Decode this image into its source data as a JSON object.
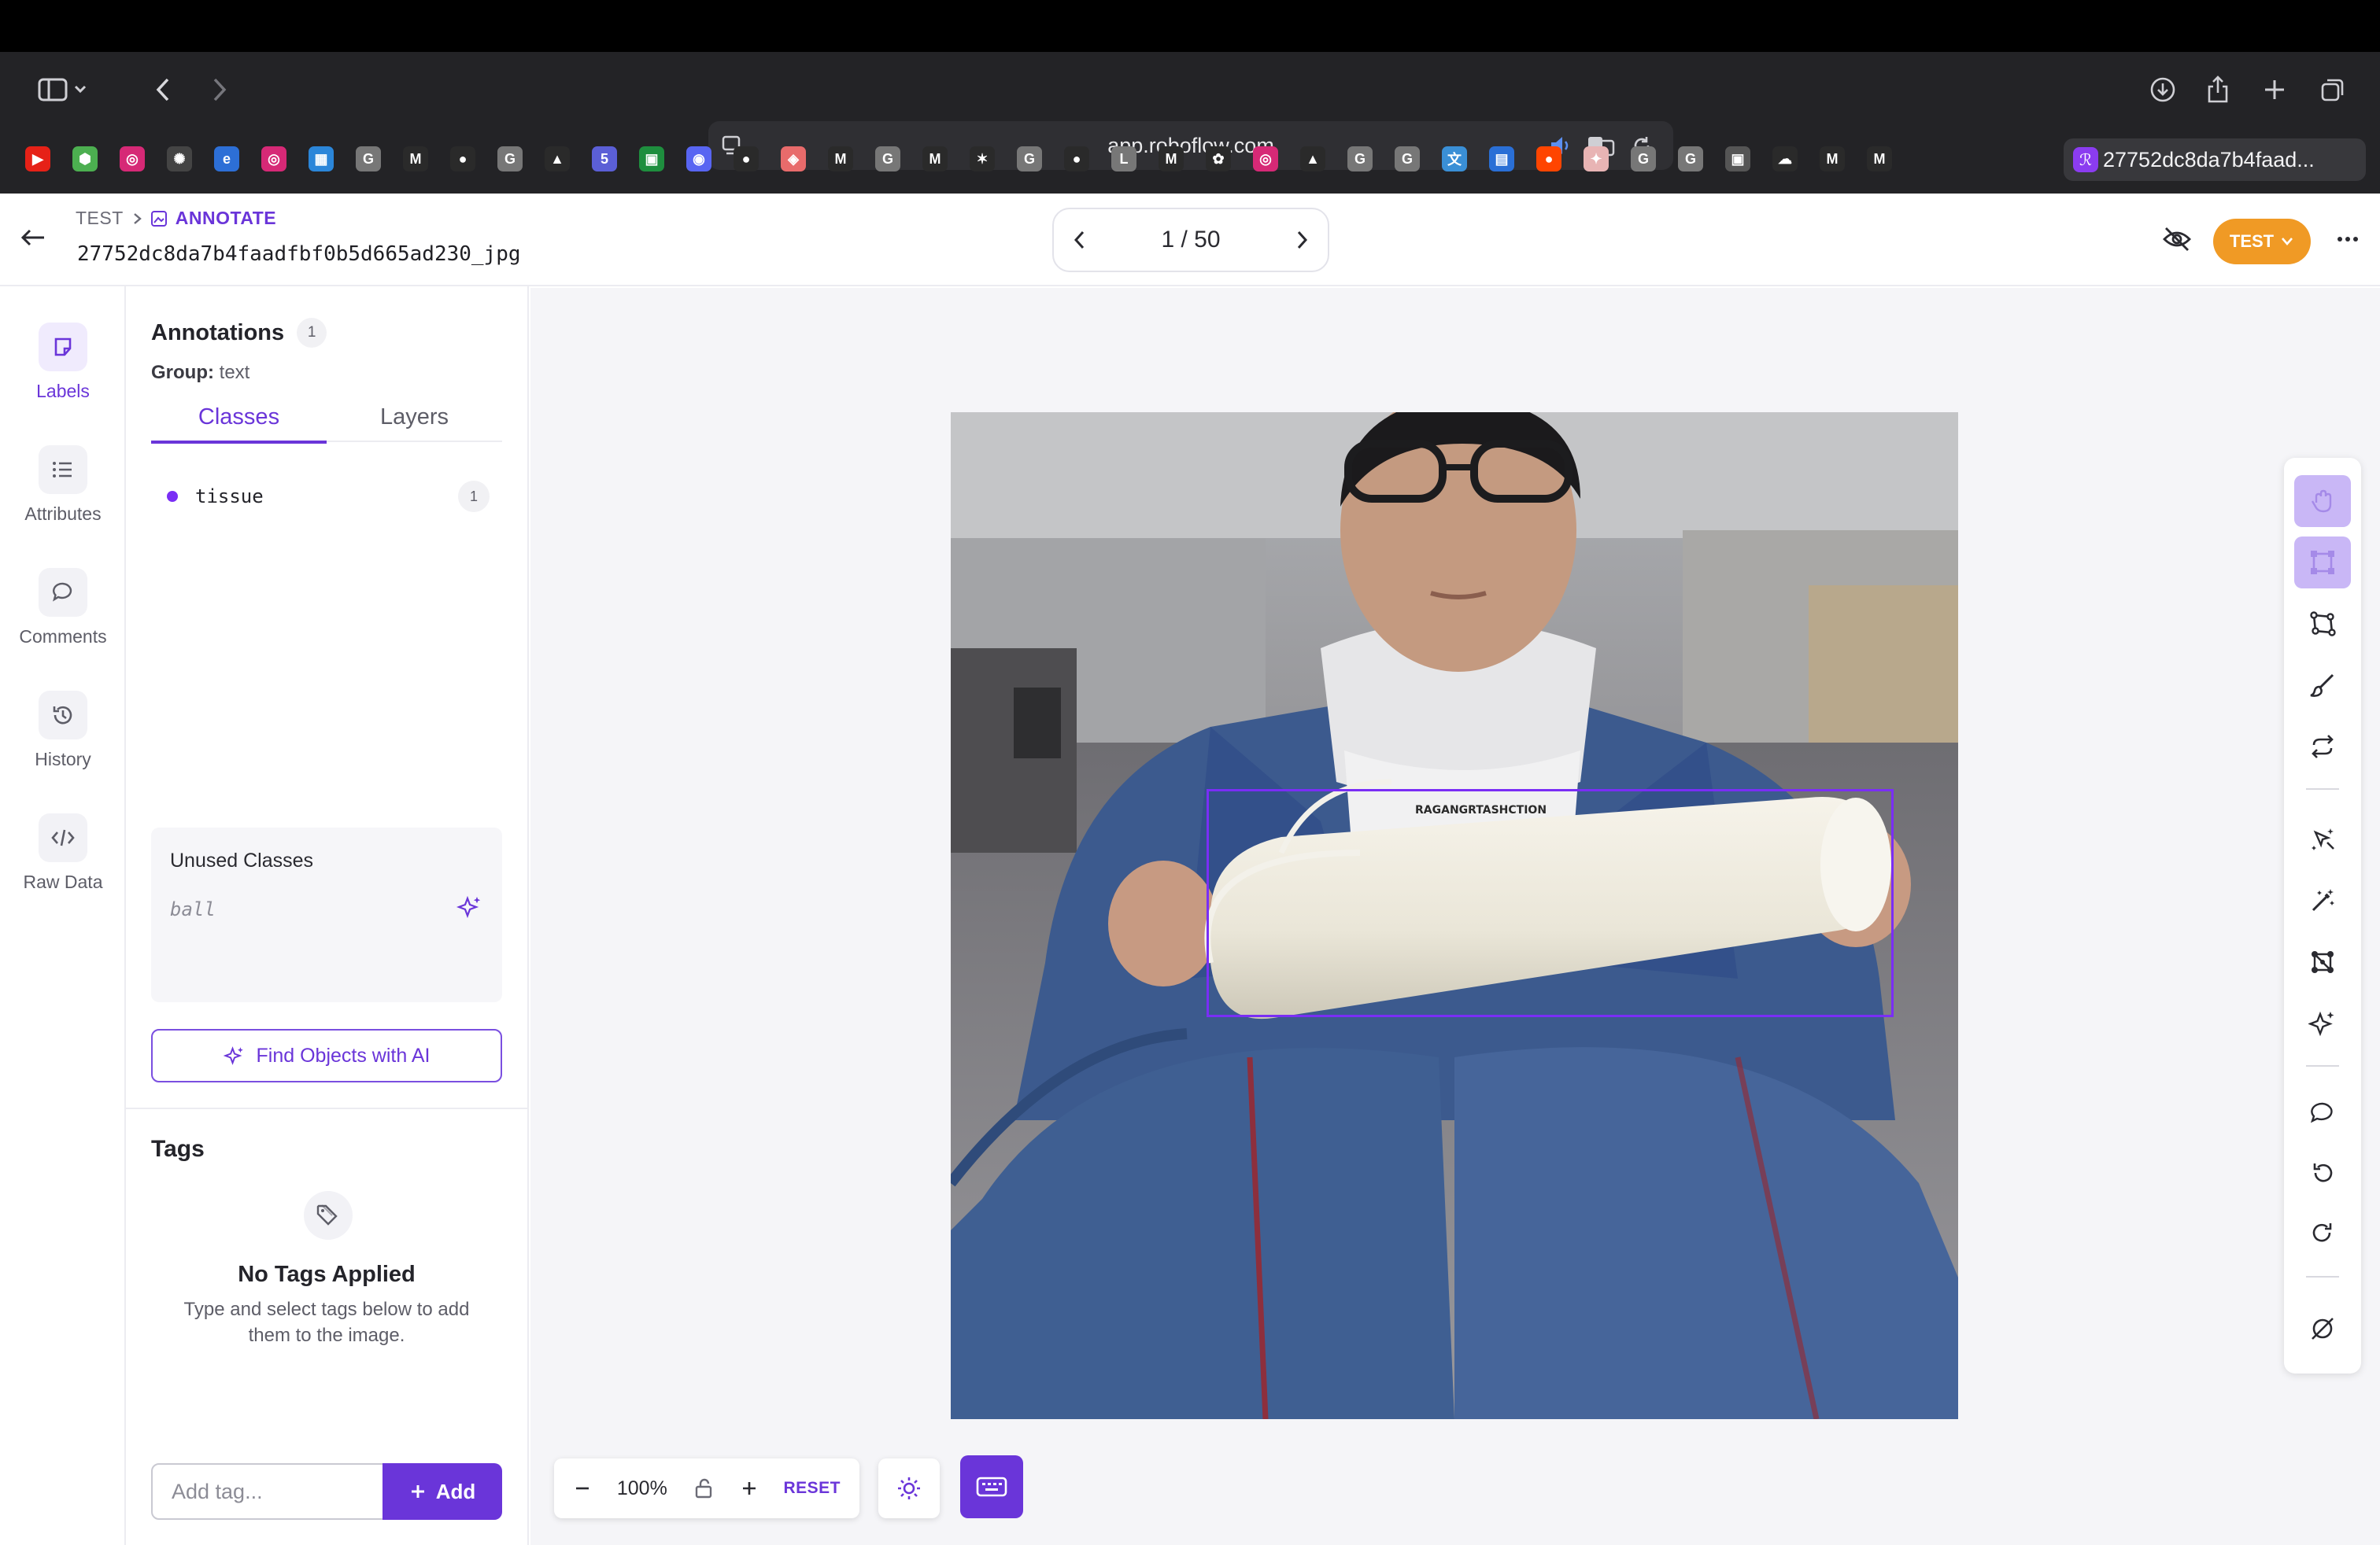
{
  "browser": {
    "url": "app.roboflow.com",
    "active_tab_title": "27752dc8da7b4faad...",
    "bookmarks": [
      {
        "icon": "youtube-icon",
        "color": "#e62117",
        "glyph": "▶"
      },
      {
        "icon": "hex-app-icon",
        "color": "#4caf50",
        "glyph": "⬢"
      },
      {
        "icon": "instagram-icon",
        "color": "#d62976",
        "glyph": "◎"
      },
      {
        "icon": "openai-icon",
        "color": "#444444",
        "glyph": "✺"
      },
      {
        "icon": "edge-icon",
        "color": "#2d6fd6",
        "glyph": "e"
      },
      {
        "icon": "instagram-icon",
        "color": "#d62976",
        "glyph": "◎"
      },
      {
        "icon": "ocr-icon",
        "color": "#2b86d9",
        "glyph": "▦"
      },
      {
        "icon": "google-g-icon",
        "color": "#777777",
        "glyph": "G"
      },
      {
        "icon": "gmail-icon",
        "color": "#2a2a2a",
        "glyph": "M"
      },
      {
        "icon": "github-icon",
        "color": "#2a2a2a",
        "glyph": "●"
      },
      {
        "icon": "google-g-icon",
        "color": "#777777",
        "glyph": "G"
      },
      {
        "icon": "google-drive-icon",
        "color": "#2a2a2a",
        "glyph": "▲"
      },
      {
        "icon": "html5-icon",
        "color": "#5b5fd6",
        "glyph": "5"
      },
      {
        "icon": "classroom-icon",
        "color": "#1e8e3e",
        "glyph": "▣"
      },
      {
        "icon": "discord-icon",
        "color": "#5865f2",
        "glyph": "◉"
      },
      {
        "icon": "github-icon",
        "color": "#2a2a2a",
        "glyph": "●"
      },
      {
        "icon": "rose-app-icon",
        "color": "#e86b6b",
        "glyph": "◈"
      },
      {
        "icon": "notion-icon",
        "color": "#2a2a2a",
        "glyph": "M"
      },
      {
        "icon": "google-g-icon",
        "color": "#777777",
        "glyph": "G"
      },
      {
        "icon": "gmail-icon",
        "color": "#2a2a2a",
        "glyph": "M"
      },
      {
        "icon": "colab-icon",
        "color": "#2a2a2a",
        "glyph": "✶"
      },
      {
        "icon": "google-g-icon",
        "color": "#777777",
        "glyph": "G"
      },
      {
        "icon": "github-icon",
        "color": "#2a2a2a",
        "glyph": "●"
      },
      {
        "icon": "letter-l-icon",
        "color": "#777777",
        "glyph": "L"
      },
      {
        "icon": "gmail-icon",
        "color": "#2a2a2a",
        "glyph": "M"
      },
      {
        "icon": "paw-icon",
        "color": "#2a2a2a",
        "glyph": "✿"
      },
      {
        "icon": "instagram-icon",
        "color": "#d62976",
        "glyph": "◎"
      },
      {
        "icon": "google-drive-icon",
        "color": "#2a2a2a",
        "glyph": "▲"
      },
      {
        "icon": "google-g-icon",
        "color": "#777777",
        "glyph": "G"
      },
      {
        "icon": "google-g-icon",
        "color": "#777777",
        "glyph": "G"
      },
      {
        "icon": "translate-icon",
        "color": "#3a8fd6",
        "glyph": "文"
      },
      {
        "icon": "doc-icon",
        "color": "#2a6fd6",
        "glyph": "▤"
      },
      {
        "icon": "reddit-icon",
        "color": "#ff4500",
        "glyph": "●"
      },
      {
        "icon": "cat-app-icon",
        "color": "#e8b4b4",
        "glyph": "✦"
      },
      {
        "icon": "google-g-icon",
        "color": "#777777",
        "glyph": "G"
      },
      {
        "icon": "google-g-icon",
        "color": "#777777",
        "glyph": "G"
      },
      {
        "icon": "contacts-icon",
        "color": "#555555",
        "glyph": "▣"
      },
      {
        "icon": "cloudflare-icon",
        "color": "#2a2a2a",
        "glyph": "☁"
      },
      {
        "icon": "gmail-icon",
        "color": "#2a2a2a",
        "glyph": "M"
      },
      {
        "icon": "gmail-icon",
        "color": "#2a2a2a",
        "glyph": "M"
      }
    ]
  },
  "header": {
    "breadcrumb_project": "TEST",
    "breadcrumb_section": "ANNOTATE",
    "filename": "27752dc8da7b4faadfbf0b5d665ad230_jpg",
    "pager": "1 / 50",
    "version_button": "TEST"
  },
  "rail": [
    {
      "label": "Labels",
      "icon": "labels-icon"
    },
    {
      "label": "Attributes",
      "icon": "list-icon"
    },
    {
      "label": "Comments",
      "icon": "comment-icon"
    },
    {
      "label": "History",
      "icon": "history-icon"
    },
    {
      "label": "Raw Data",
      "icon": "code-icon"
    }
  ],
  "panel": {
    "title": "Annotations",
    "count": "1",
    "group_label": "Group:",
    "group_value": "text",
    "tabs": [
      "Classes",
      "Layers"
    ],
    "classes": [
      {
        "name": "tissue",
        "count": "1",
        "color": "#7a2ef5"
      }
    ],
    "unused_title": "Unused Classes",
    "unused_classes": [
      "ball"
    ],
    "find_ai": "Find Objects with AI",
    "tags_title": "Tags",
    "no_tags_title": "No Tags Applied",
    "no_tags_desc": "Type and select tags below to add them to the image.",
    "tag_placeholder": "Add tag...",
    "add_label": "Add"
  },
  "canvas": {
    "zoom": "100%",
    "reset_label": "RESET",
    "box_color": "#7a2ef5",
    "box_label_text": "RAGANGRTASHCTION"
  }
}
